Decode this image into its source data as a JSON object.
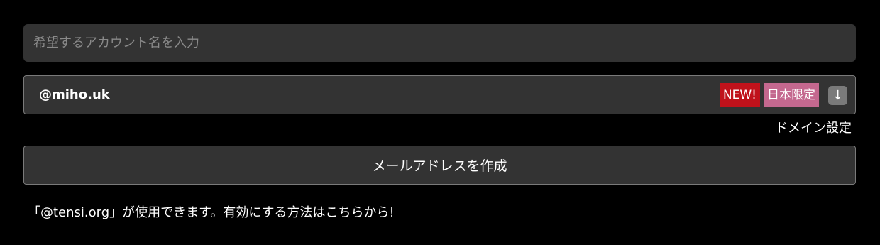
{
  "account": {
    "placeholder": "希望するアカウント名を入力",
    "value": ""
  },
  "domain": {
    "selected": "@miho.uk",
    "badges": {
      "new": "NEW!",
      "japan_only": "日本限定"
    },
    "arrow_icon": "arrow-down-icon"
  },
  "domain_settings_label": "ドメイン設定",
  "create_button_label": "メールアドレスを作成",
  "notice_text": "「@tensi.org」が使用できます。有効にする方法はこちらから!",
  "colors": {
    "background": "#000000",
    "field": "#333333",
    "badge_new": "#c0121b",
    "badge_japan": "#c4688f",
    "arrow_button": "#7a7a7a"
  }
}
